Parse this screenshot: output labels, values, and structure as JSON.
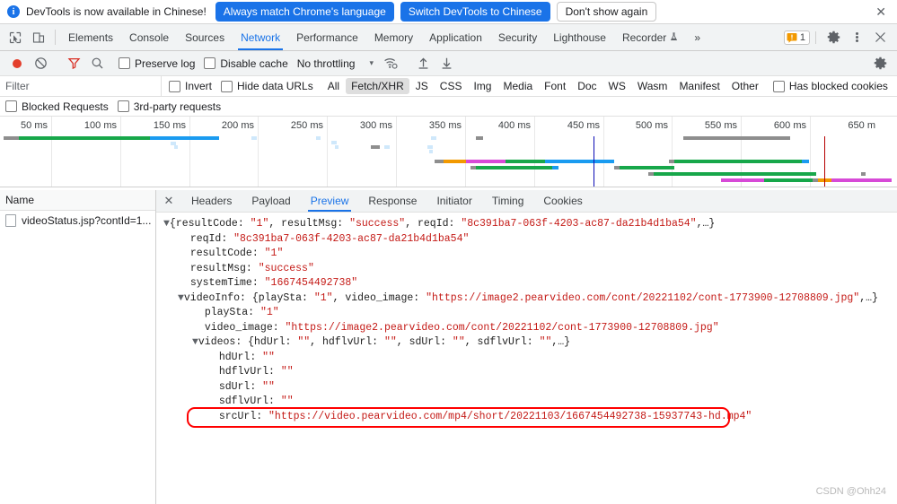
{
  "notice": {
    "icon": "info-icon",
    "message": "DevTools is now available in Chinese!",
    "primary_button": "Always match Chrome's language",
    "secondary_button": "Switch DevTools to Chinese",
    "dismiss_button": "Don't show again",
    "close_icon": "✕",
    "accent_color": "#1a73e8"
  },
  "main_tabs": {
    "inspect_icon": "inspect-element-icon",
    "device_icon": "device-toolbar-icon",
    "items": [
      {
        "label": "Elements",
        "selected": false
      },
      {
        "label": "Console",
        "selected": false
      },
      {
        "label": "Sources",
        "selected": false
      },
      {
        "label": "Network",
        "selected": true
      },
      {
        "label": "Performance",
        "selected": false
      },
      {
        "label": "Memory",
        "selected": false
      },
      {
        "label": "Application",
        "selected": false
      },
      {
        "label": "Security",
        "selected": false
      },
      {
        "label": "Lighthouse",
        "selected": false
      },
      {
        "label": "Recorder",
        "selected": false
      }
    ],
    "overflow_label": "»",
    "warning_count": "1",
    "settings_icon": "gear-icon",
    "more_icon": "kebab-menu-icon",
    "close_icon": "✕"
  },
  "net_toolbar": {
    "record_icon": "record-stop-icon",
    "clear_icon": "clear-icon",
    "filter_icon": "filter-funnel-icon",
    "search_icon": "search-icon",
    "preserve_log": "Preserve log",
    "disable_cache": "Disable cache",
    "throttling": "No throttling",
    "throttling_caret": "▾",
    "wifi_icon": "network-conditions-icon",
    "import_icon": "import-har-icon",
    "export_icon": "export-har-icon",
    "settings_icon": "gear-icon"
  },
  "filter_row": {
    "placeholder": "Filter",
    "value": "",
    "invert": "Invert",
    "hide_data_urls": "Hide data URLs",
    "types": [
      {
        "label": "All",
        "active": false
      },
      {
        "label": "Fetch/XHR",
        "active": true
      },
      {
        "label": "JS",
        "active": false
      },
      {
        "label": "CSS",
        "active": false
      },
      {
        "label": "Img",
        "active": false
      },
      {
        "label": "Media",
        "active": false
      },
      {
        "label": "Font",
        "active": false
      },
      {
        "label": "Doc",
        "active": false
      },
      {
        "label": "WS",
        "active": false
      },
      {
        "label": "Wasm",
        "active": false
      },
      {
        "label": "Manifest",
        "active": false
      },
      {
        "label": "Other",
        "active": false
      }
    ],
    "has_blocked_cookies": "Has blocked cookies",
    "blocked_requests": "Blocked Requests",
    "third_party_requests": "3rd-party requests"
  },
  "overview": {
    "ticks": [
      "50 ms",
      "100 ms",
      "150 ms",
      "200 ms",
      "250 ms",
      "300 ms",
      "350 ms",
      "400 ms",
      "450 ms",
      "500 ms",
      "550 ms",
      "600 ms",
      "650 m"
    ],
    "dcl_color": "#0b0bb5",
    "load_color": "#b60000",
    "selection_color": "#1a73e8"
  },
  "requests_panel": {
    "column_header": "Name",
    "rows": [
      {
        "name": "videoStatus.jsp?contId=1...",
        "selected": true
      }
    ]
  },
  "detail_tabs": {
    "close_icon": "✕",
    "items": [
      {
        "label": "Headers",
        "selected": false
      },
      {
        "label": "Payload",
        "selected": false
      },
      {
        "label": "Preview",
        "selected": true
      },
      {
        "label": "Response",
        "selected": false
      },
      {
        "label": "Initiator",
        "selected": false
      },
      {
        "label": "Timing",
        "selected": false
      },
      {
        "label": "Cookies",
        "selected": false
      }
    ]
  },
  "preview": {
    "lines": [
      {
        "indent": 0,
        "arrow": "▼",
        "parts": [
          {
            "t": "{",
            "c": "punc"
          },
          {
            "t": "resultCode: ",
            "c": "keyplain"
          },
          {
            "t": "\"1\"",
            "c": "str"
          },
          {
            "t": ", resultMsg: ",
            "c": "keyplain"
          },
          {
            "t": "\"success\"",
            "c": "str"
          },
          {
            "t": ", reqId: ",
            "c": "keyplain"
          },
          {
            "t": "\"8c391ba7-063f-4203-ac87-da21b4d1ba54\"",
            "c": "str"
          },
          {
            "t": ",…}",
            "c": "punc"
          }
        ]
      },
      {
        "indent": 1,
        "arrow": "",
        "parts": [
          {
            "t": "reqId: ",
            "c": "keyplain"
          },
          {
            "t": "\"8c391ba7-063f-4203-ac87-da21b4d1ba54\"",
            "c": "str"
          }
        ]
      },
      {
        "indent": 1,
        "arrow": "",
        "parts": [
          {
            "t": "resultCode: ",
            "c": "keyplain"
          },
          {
            "t": "\"1\"",
            "c": "str"
          }
        ]
      },
      {
        "indent": 1,
        "arrow": "",
        "parts": [
          {
            "t": "resultMsg: ",
            "c": "keyplain"
          },
          {
            "t": "\"success\"",
            "c": "str"
          }
        ]
      },
      {
        "indent": 1,
        "arrow": "",
        "parts": [
          {
            "t": "systemTime: ",
            "c": "keyplain"
          },
          {
            "t": "\"1667454492738\"",
            "c": "str"
          }
        ]
      },
      {
        "indent": 1,
        "arrow": "▼",
        "parts": [
          {
            "t": "videoInfo: {",
            "c": "keyplain"
          },
          {
            "t": "playSta: ",
            "c": "keyplain"
          },
          {
            "t": "\"1\"",
            "c": "str"
          },
          {
            "t": ", video_image: ",
            "c": "keyplain"
          },
          {
            "t": "\"https://image2.pearvideo.com/cont/20221102/cont-1773900-12708809.jpg\"",
            "c": "str"
          },
          {
            "t": ",…}",
            "c": "punc"
          }
        ]
      },
      {
        "indent": 2,
        "arrow": "",
        "parts": [
          {
            "t": "playSta: ",
            "c": "keyplain"
          },
          {
            "t": "\"1\"",
            "c": "str"
          }
        ]
      },
      {
        "indent": 2,
        "arrow": "",
        "parts": [
          {
            "t": "video_image: ",
            "c": "keyplain"
          },
          {
            "t": "\"https://image2.pearvideo.com/cont/20221102/cont-1773900-12708809.jpg\"",
            "c": "str"
          }
        ]
      },
      {
        "indent": 2,
        "arrow": "▼",
        "parts": [
          {
            "t": "videos: {",
            "c": "keyplain"
          },
          {
            "t": "hdUrl: ",
            "c": "keyplain"
          },
          {
            "t": "\"\"",
            "c": "str"
          },
          {
            "t": ", hdflvUrl: ",
            "c": "keyplain"
          },
          {
            "t": "\"\"",
            "c": "str"
          },
          {
            "t": ", sdUrl: ",
            "c": "keyplain"
          },
          {
            "t": "\"\"",
            "c": "str"
          },
          {
            "t": ", sdflvUrl: ",
            "c": "keyplain"
          },
          {
            "t": "\"\"",
            "c": "str"
          },
          {
            "t": ",…}",
            "c": "punc"
          }
        ]
      },
      {
        "indent": 3,
        "arrow": "",
        "parts": [
          {
            "t": "hdUrl: ",
            "c": "keyplain"
          },
          {
            "t": "\"\"",
            "c": "str"
          }
        ]
      },
      {
        "indent": 3,
        "arrow": "",
        "parts": [
          {
            "t": "hdflvUrl: ",
            "c": "keyplain"
          },
          {
            "t": "\"\"",
            "c": "str"
          }
        ]
      },
      {
        "indent": 3,
        "arrow": "",
        "parts": [
          {
            "t": "sdUrl: ",
            "c": "keyplain"
          },
          {
            "t": "\"\"",
            "c": "str"
          }
        ]
      },
      {
        "indent": 3,
        "arrow": "",
        "parts": [
          {
            "t": "sdflvUrl: ",
            "c": "keyplain"
          },
          {
            "t": "\"\"",
            "c": "str"
          }
        ]
      },
      {
        "indent": 3,
        "arrow": "",
        "highlight": true,
        "parts": [
          {
            "t": "srcUrl: ",
            "c": "keyplain"
          },
          {
            "t": "\"https://video.pearvideo.com/mp4/short/20221103/1667454492738-15937743-hd.mp4\"",
            "c": "str"
          }
        ]
      }
    ],
    "highlight_color": "#ff0000"
  },
  "watermark": "CSDN @Ohh24"
}
